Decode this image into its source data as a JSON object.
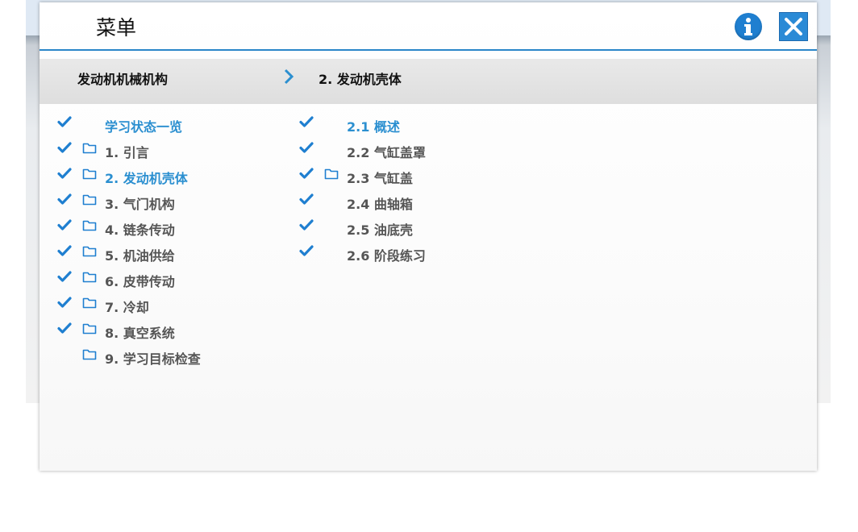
{
  "modal": {
    "title": "菜单",
    "info_icon": "info-icon",
    "close_icon": "close-icon"
  },
  "breadcrumb": {
    "level1": "发动机机械机构",
    "separator_icon": "chevron-right-icon",
    "level2": "2. 发动机壳体"
  },
  "chapters": [
    {
      "label": "学习状态一览",
      "checked": true,
      "folder": false,
      "active": true
    },
    {
      "label": "1. 引言",
      "checked": true,
      "folder": true,
      "active": false
    },
    {
      "label": "2. 发动机壳体",
      "checked": true,
      "folder": true,
      "active": true
    },
    {
      "label": "3. 气门机构",
      "checked": true,
      "folder": true,
      "active": false
    },
    {
      "label": "4. 链条传动",
      "checked": true,
      "folder": true,
      "active": false
    },
    {
      "label": "5. 机油供给",
      "checked": true,
      "folder": true,
      "active": false
    },
    {
      "label": "6. 皮带传动",
      "checked": true,
      "folder": true,
      "active": false
    },
    {
      "label": "7. 冷却",
      "checked": true,
      "folder": true,
      "active": false
    },
    {
      "label": "8. 真空系统",
      "checked": true,
      "folder": true,
      "active": false
    },
    {
      "label": "9. 学习目标检查",
      "checked": false,
      "folder": true,
      "active": false
    }
  ],
  "sections": [
    {
      "label": "2.1 概述",
      "checked": true,
      "folder": false,
      "active": true
    },
    {
      "label": "2.2 气缸盖罩",
      "checked": true,
      "folder": false,
      "active": false
    },
    {
      "label": "2.3 气缸盖",
      "checked": true,
      "folder": true,
      "active": false
    },
    {
      "label": "2.4 曲轴箱",
      "checked": true,
      "folder": false,
      "active": false
    },
    {
      "label": "2.5 油底壳",
      "checked": true,
      "folder": false,
      "active": false
    },
    {
      "label": "2.6 阶段练习",
      "checked": true,
      "folder": false,
      "active": false
    }
  ],
  "colors": {
    "accent": "#2b8fd0",
    "text_inactive": "#555555",
    "check": "#1f7fd0"
  }
}
